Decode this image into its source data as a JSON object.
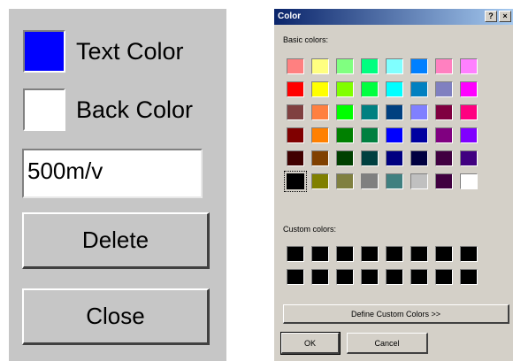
{
  "panel": {
    "text_color_label": "Text Color",
    "back_color_label": "Back Color",
    "text_color_value": "#0000ff",
    "back_color_value": "#ffffff",
    "value_field": "500m/v",
    "delete_label": "Delete",
    "close_label": "Close",
    "background_color": "#c6c6c6"
  },
  "dialog": {
    "title": "Color",
    "help_button": "?",
    "close_button": "×",
    "basic_label": "Basic colors:",
    "custom_label": "Custom colors:",
    "define_label": "Define Custom Colors >>",
    "ok_label": "OK",
    "cancel_label": "Cancel",
    "basic_colors": [
      [
        "#ff8080",
        "#ffff80",
        "#80ff80",
        "#00ff80",
        "#80ffff",
        "#0080ff",
        "#ff80c0",
        "#ff80ff"
      ],
      [
        "#ff0000",
        "#ffff00",
        "#80ff00",
        "#00ff40",
        "#00ffff",
        "#0080c0",
        "#8080c0",
        "#ff00ff"
      ],
      [
        "#804040",
        "#ff8040",
        "#00ff00",
        "#008080",
        "#004080",
        "#8080ff",
        "#800040",
        "#ff0080"
      ],
      [
        "#800000",
        "#ff8000",
        "#008000",
        "#008040",
        "#0000ff",
        "#0000a0",
        "#800080",
        "#8000ff"
      ],
      [
        "#400000",
        "#804000",
        "#004000",
        "#004040",
        "#000080",
        "#000040",
        "#400040",
        "#400080"
      ],
      [
        "#000000",
        "#808000",
        "#808040",
        "#808080",
        "#408080",
        "#c0c0c0",
        "#400040",
        "#ffffff"
      ]
    ],
    "selected_basic": "5-0",
    "custom_colors": [
      [
        "#000000",
        "#000000",
        "#000000",
        "#000000",
        "#000000",
        "#000000",
        "#000000",
        "#000000"
      ],
      [
        "#000000",
        "#000000",
        "#000000",
        "#000000",
        "#000000",
        "#000000",
        "#000000",
        "#000000"
      ]
    ]
  }
}
